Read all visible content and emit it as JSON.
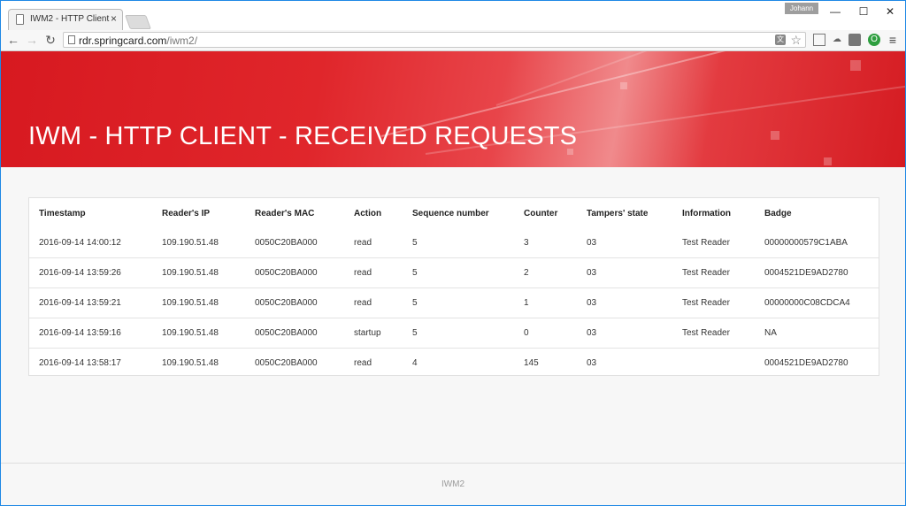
{
  "browser": {
    "tab_title": "IWM2 - HTTP Client",
    "tab_close": "×",
    "user_badge": "Johann",
    "minimize": "—",
    "maximize": "☐",
    "close": "✕",
    "back": "←",
    "forward": "→",
    "reload": "↻",
    "url_host": "rdr.springcard.com",
    "url_path": "/iwm2/",
    "menu": "≡"
  },
  "hero": {
    "title": "IWM - HTTP CLIENT - RECEIVED REQUESTS",
    "brand_color": "#d71920"
  },
  "table": {
    "headers": [
      "Timestamp",
      "Reader's IP",
      "Reader's MAC",
      "Action",
      "Sequence number",
      "Counter",
      "Tampers' state",
      "Information",
      "Badge"
    ],
    "rows": [
      [
        "2016-09-14 14:00:12",
        "109.190.51.48",
        "0050C20BA000",
        "read",
        "5",
        "3",
        "03",
        "Test Reader",
        "00000000579C1ABA"
      ],
      [
        "2016-09-14 13:59:26",
        "109.190.51.48",
        "0050C20BA000",
        "read",
        "5",
        "2",
        "03",
        "Test Reader",
        "0004521DE9AD2780"
      ],
      [
        "2016-09-14 13:59:21",
        "109.190.51.48",
        "0050C20BA000",
        "read",
        "5",
        "1",
        "03",
        "Test Reader",
        "00000000C08CDCA4"
      ],
      [
        "2016-09-14 13:59:16",
        "109.190.51.48",
        "0050C20BA000",
        "startup",
        "5",
        "0",
        "03",
        "Test Reader",
        "NA"
      ],
      [
        "2016-09-14 13:58:17",
        "109.190.51.48",
        "0050C20BA000",
        "read",
        "4",
        "145",
        "03",
        "",
        "0004521DE9AD2780"
      ]
    ]
  },
  "footer": {
    "text": "IWM2"
  }
}
